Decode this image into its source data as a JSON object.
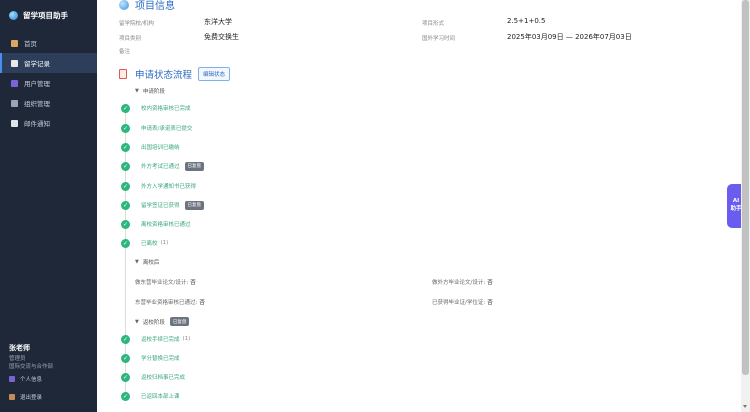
{
  "app": {
    "title": "留学项目助手"
  },
  "sidebar": {
    "items": [
      {
        "label": "首页",
        "icon": "home-icon"
      },
      {
        "label": "留学记录",
        "icon": "document-icon",
        "active": true
      },
      {
        "label": "用户管理",
        "icon": "users-icon"
      },
      {
        "label": "组织管理",
        "icon": "building-icon"
      },
      {
        "label": "邮件通知",
        "icon": "mail-icon"
      }
    ],
    "user": {
      "name": "张老师",
      "role": "管理员",
      "dept": "国际交流与合作部"
    },
    "profile_label": "个人信息",
    "logout_label": "退出登录"
  },
  "project": {
    "title": "项目信息",
    "fields": {
      "school_label": "留学院校/机构",
      "school_value": "东洋大学",
      "form_label": "项目形式",
      "form_value": "2.5+1+0.5",
      "type_label": "项目类别",
      "type_value": "免费交换生",
      "period_label": "国外学习时间",
      "period_value": "2025年03月09日 — 2026年07月03日",
      "remark_label": "备注"
    }
  },
  "status": {
    "title": "申请状态流程",
    "edit_label": "编辑状态",
    "groups": {
      "apply": {
        "label": "申请阶段"
      },
      "after_return": {
        "label": "离校后"
      },
      "return_phase": {
        "label": "返校阶段",
        "badge": "已复盘"
      }
    },
    "steps": [
      {
        "label": "校内资格审核已完成"
      },
      {
        "label": "申请表/承诺表已提交"
      },
      {
        "label": "出国培训已缴纳"
      },
      {
        "label": "外方考试已通过",
        "badge": "已复盘"
      },
      {
        "label": "外方入学通知书已获得"
      },
      {
        "label": "留学签证已获得",
        "badge": "已复盘"
      },
      {
        "label": "离校资格审核已通过"
      },
      {
        "label": "已离校",
        "count": "(1)"
      }
    ],
    "return_steps": [
      {
        "label": "返校手续已完成",
        "count": "(1)"
      },
      {
        "label": "学分替换已完成"
      },
      {
        "label": "返校归档事已完成"
      },
      {
        "label": "已返回本部上课"
      }
    ],
    "after_fields": {
      "f1_label": "做东营毕业论文/设计:",
      "f1_value": "否",
      "f2_label": "做外方毕业论文/设计:",
      "f2_value": "否",
      "f3_label": "东营毕业资格审核已通过:",
      "f3_value": "否",
      "f4_label": "已获得毕业证/学位证:",
      "f4_value": "否"
    }
  },
  "ai_assistant": {
    "label_line1": "AI",
    "label_line2": "助手"
  },
  "colors": {
    "sidebar_bg": "#1e2838",
    "accent": "#2a6bc4",
    "success": "#2cb67d",
    "ai": "#6b5cf0"
  }
}
